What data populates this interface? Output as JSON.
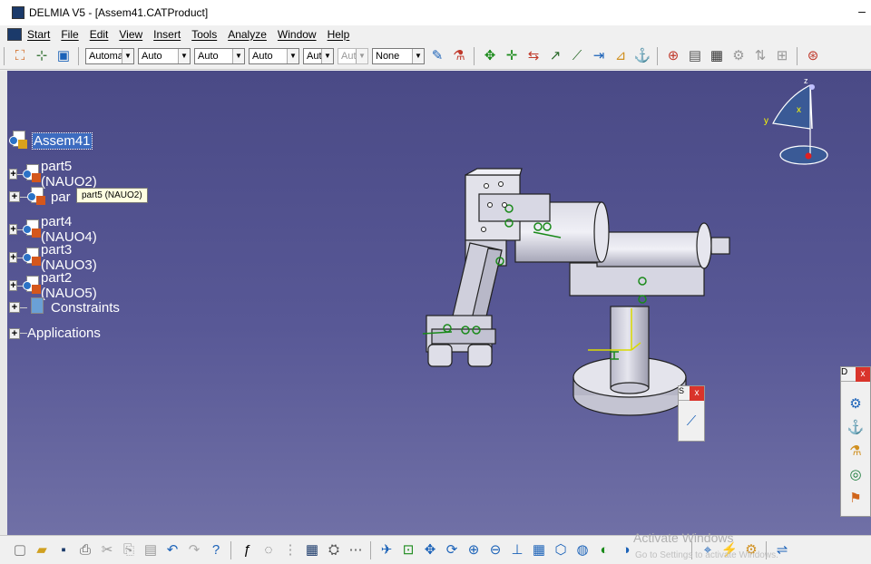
{
  "window": {
    "title": "DELMIA V5 - [Assem41.CATProduct]",
    "minimize": "–"
  },
  "menu": [
    "Start",
    "File",
    "Edit",
    "View",
    "Insert",
    "Tools",
    "Analyze",
    "Window",
    "Help"
  ],
  "toolbar": {
    "combos": [
      {
        "value": "Automa",
        "disabled": false
      },
      {
        "value": "Auto",
        "disabled": false
      },
      {
        "value": "Auto",
        "disabled": false
      },
      {
        "value": "Auto",
        "disabled": false
      },
      {
        "value": "Aut",
        "disabled": false
      },
      {
        "value": "Aut",
        "disabled": true
      },
      {
        "value": "None",
        "disabled": false
      }
    ]
  },
  "tree": {
    "root": "Assem41",
    "items": [
      {
        "label": "part5 (NAUO2)"
      },
      {
        "label": "par"
      },
      {
        "label": "part4 (NAUO4)"
      },
      {
        "label": "part3 (NAUO3)"
      },
      {
        "label": "part2 (NAUO5)"
      },
      {
        "label": "Constraints"
      },
      {
        "label": "Applications"
      }
    ]
  },
  "tooltip": "part5 (NAUO2)",
  "compass": {
    "z": "z",
    "x": "x",
    "y": "y"
  },
  "floating": {
    "tool1_label": "D",
    "tool2_label": "S"
  },
  "status": {
    "watermark": "Activate Windows",
    "watermark_sub": "Go to Settings to activate Windows."
  }
}
